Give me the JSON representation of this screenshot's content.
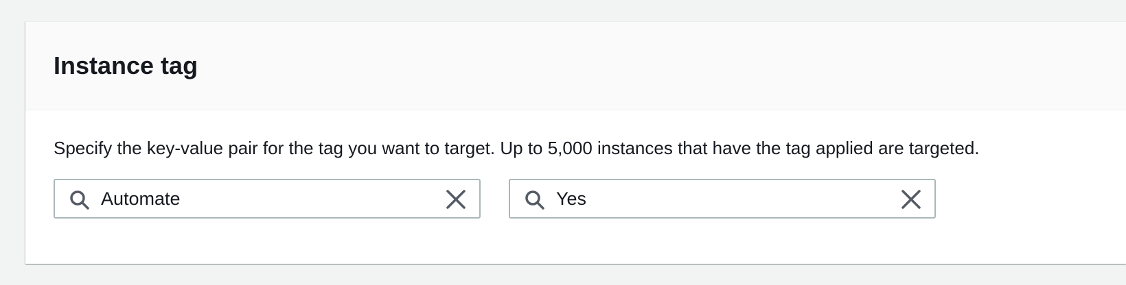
{
  "panel": {
    "title": "Instance tag",
    "description": "Specify the key-value pair for the tag you want to target. Up to 5,000 instances that have the tag applied are targeted."
  },
  "tag_key": {
    "value": "Automate",
    "icon": "search-icon",
    "clear_icon": "close-icon"
  },
  "tag_value": {
    "value": "Yes",
    "icon": "search-icon",
    "clear_icon": "close-icon"
  },
  "colors": {
    "background": "#f2f3f3",
    "header_background": "#fafafa",
    "text": "#16191f",
    "icon": "#545b64",
    "input_border": "#aab7b8"
  }
}
